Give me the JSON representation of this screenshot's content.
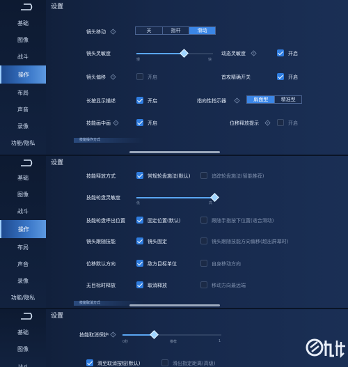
{
  "sidebar": {
    "items": [
      "基础",
      "图像",
      "战斗",
      "操作",
      "布局",
      "声音",
      "录像",
      "功能/隐私"
    ],
    "active_index": 3
  },
  "settings_title": "设置",
  "panel1": {
    "camera_move": {
      "label": "镜头移动",
      "options": [
        "关",
        "指杆",
        "滑动"
      ],
      "selected": 2
    },
    "camera_sensitivity": {
      "label": "镜头灵敏度",
      "min_label": "慢",
      "max_label": "快",
      "value": 0.62
    },
    "dynamic_sensitivity": {
      "label": "动态灵敏度",
      "state": "开启"
    },
    "camera_offset": {
      "label": "镜头偏移",
      "state": "开启"
    },
    "first_precise": {
      "label": "首攻精确开关",
      "state": "开启"
    },
    "long_press_desc": {
      "label": "长按显示描述",
      "state": "开启"
    },
    "direction_indicator": {
      "label": "指向性指示器",
      "options": [
        "扇面型",
        "精准型"
      ],
      "selected": 0
    },
    "skill_screen_center": {
      "label": "技能画中画",
      "state": "开启"
    },
    "move_cast_hint": {
      "label": "位移释放提示",
      "state": "开启"
    },
    "section_label": "技能操作方式"
  },
  "panel2": {
    "cast_mode": {
      "label": "技能释放方式",
      "option_a": "常规轮盘施法(默认)",
      "option_b": "追踪轮盘施法(智能推荐)"
    },
    "wheel_sensitivity": {
      "label": "技能轮盘灵敏度",
      "min_label": "低",
      "max_label": "高",
      "value": 0.98
    },
    "wheel_position": {
      "label": "技能轮盘呼出位置",
      "option_a": "固定位置(默认)",
      "option_b": "跟随手指按下位置(适合滑动)"
    },
    "camera_follow": {
      "label": "镜头跟随技能",
      "option_a": "镜头固定",
      "option_b": "镜头跟随技能方向偏移(超出屏幕时)"
    },
    "move_default_dir": {
      "label": "位移默认方向",
      "option_a": "敌方目标单位",
      "option_b": "自身移动方向"
    },
    "no_target_cast": {
      "label": "无目标时释放",
      "option_a": "取消释放",
      "option_b": "移动方向最远端"
    },
    "section_label": "技能取消方式"
  },
  "panel3": {
    "cancel_protect": {
      "label": "技能取消保护",
      "ticks": [
        "0秒",
        "推荐",
        "1"
      ],
      "value": 0.32
    },
    "cancel_option_a": "滑至取消按钮(默认)",
    "cancel_option_b": "滑出指定距离(高级)"
  },
  "colors": {
    "accent": "#3b86e6",
    "active_tab": "#3a77c8",
    "background": "#16284a"
  }
}
